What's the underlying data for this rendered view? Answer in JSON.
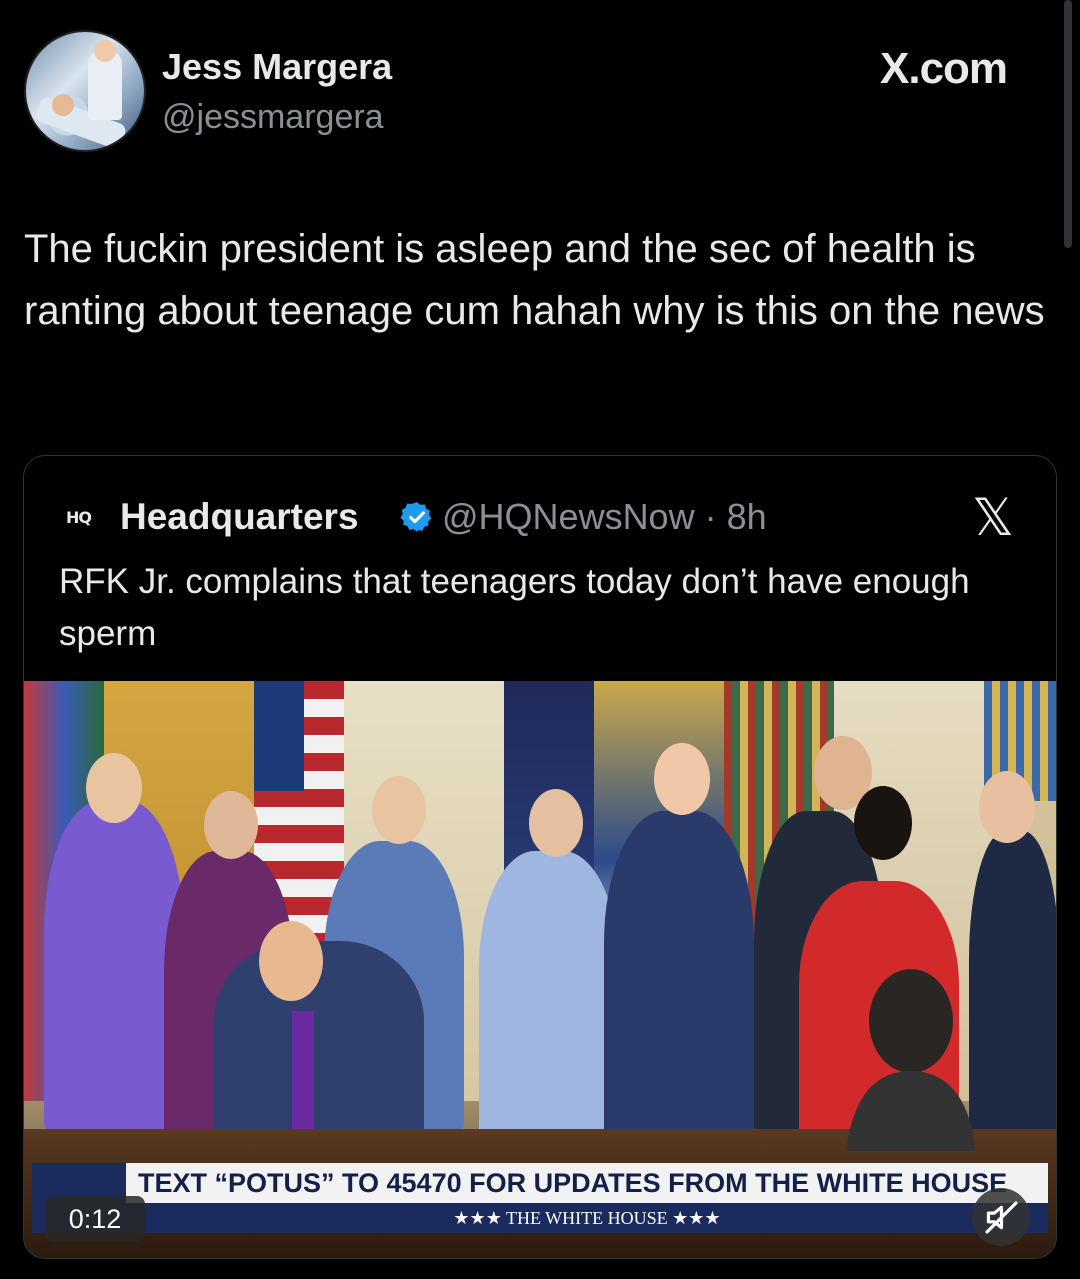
{
  "author": {
    "name": "Jess Margera",
    "handle": "@jessmargera"
  },
  "brand": "X.com",
  "tweet": {
    "text": "The fuckin president is asleep and the sec of health is ranting about teenage cum hahah why is this on the news"
  },
  "quoted": {
    "logo": "HQ",
    "name": "Headquarters",
    "meta": "@HQNewsNow · 8h",
    "x_glyph": "𝕏",
    "text": "RFK Jr. complains that teenagers today don’t have enough sperm"
  },
  "video": {
    "banner_top": "TEXT “POTUS” TO 45470 FOR UPDATES FROM THE WHITE HOUSE",
    "banner_bottom": "★★★ THE WHITE HOUSE ★★★",
    "time": "0:12"
  },
  "colors": {
    "background": "#000000",
    "text": "#e7e9ea",
    "muted": "#8b9096",
    "verified": "#1d9bf0"
  }
}
